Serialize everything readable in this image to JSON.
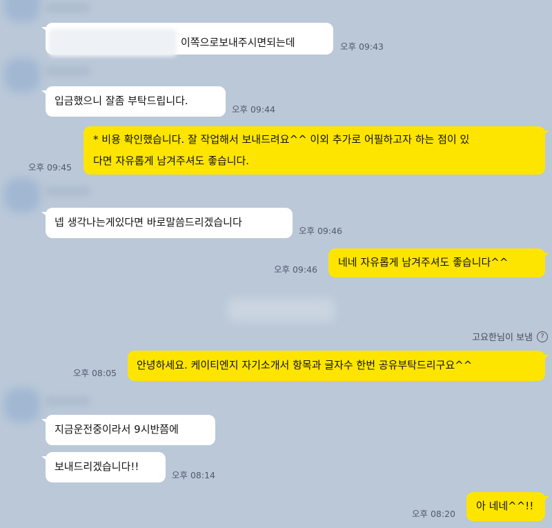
{
  "messages": [
    {
      "side": "in",
      "text": "이쪽으로보내주시면되는데",
      "time": "오후 09:43"
    },
    {
      "side": "in",
      "text": "입금했으니 잘좀 부탁드립니다.",
      "time": "오후 09:44"
    },
    {
      "side": "out",
      "lines": [
        "* 비용 확인했습니다. 잘 작업해서 보내드려요^^ 이외 추가로 어필하고자 하는 점이 있",
        "다면 자유롭게 남겨주셔도 좋습니다."
      ],
      "time": "오후 09:45"
    },
    {
      "side": "in",
      "text": "넵 생각나는게있다면 바로말씀드리겠습니다",
      "time": "오후 09:46"
    },
    {
      "side": "out",
      "text": "네네 자유롭게 남겨주셔도 좋습니다^^",
      "time": "오후 09:46"
    },
    {
      "side": "out",
      "text": "안녕하세요. 케이티엔지 자기소개서 항목과 글자수 한번 공유부탁드리구요^^",
      "time": "오후 08:05"
    },
    {
      "side": "in",
      "text": "지금운전중이라서 9시반쯤에"
    },
    {
      "side": "in",
      "text": "보내드리겠습니다!!",
      "time": "오후 08:14"
    },
    {
      "side": "out",
      "text": "아 네네^^!!",
      "time": "오후 08:20"
    }
  ],
  "status": {
    "sent_by": "고요한님이 보냄",
    "help_icon": "?"
  }
}
